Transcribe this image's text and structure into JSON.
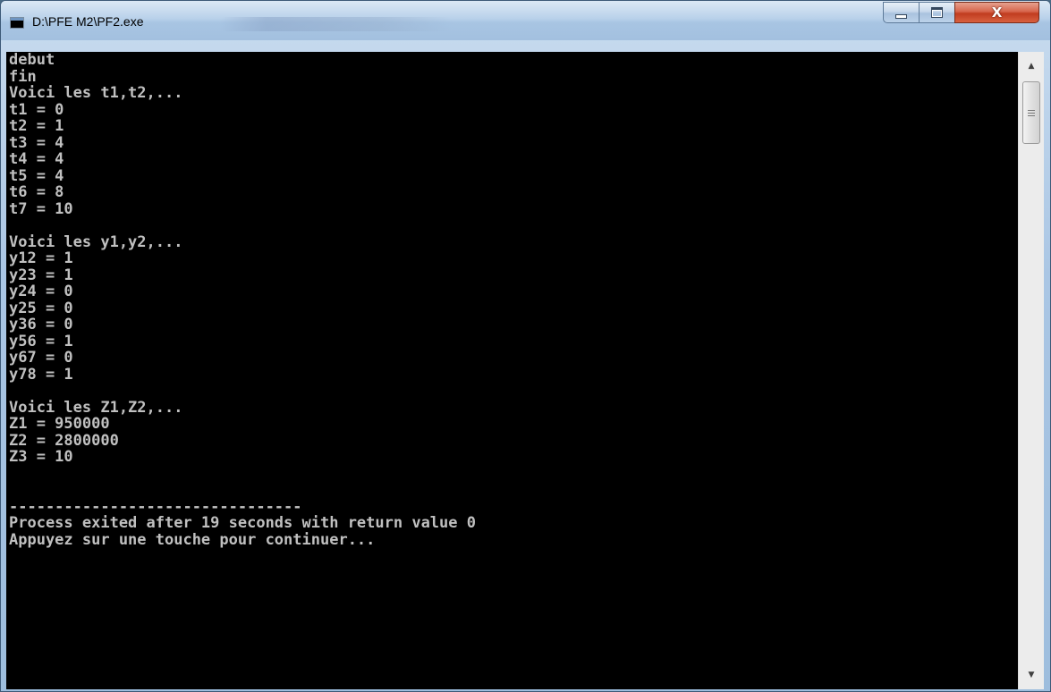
{
  "window": {
    "title": "D:\\PFE M2\\PF2.exe",
    "close_symbol": "X",
    "icons": {
      "app": "console-app-icon",
      "minimize": "minimize-icon",
      "maximize": "maximize-icon",
      "close": "close-icon"
    }
  },
  "console": {
    "lines": [
      "debut",
      "fin",
      "Voici les t1,t2,...",
      "t1 = 0",
      "t2 = 1",
      "t3 = 4",
      "t4 = 4",
      "t5 = 4",
      "t6 = 8",
      "t7 = 10",
      "",
      "Voici les y1,y2,...",
      "y12 = 1",
      "y23 = 1",
      "y24 = 0",
      "y25 = 0",
      "y36 = 0",
      "y56 = 1",
      "y67 = 0",
      "y78 = 1",
      "",
      "Voici les Z1,Z2,...",
      "Z1 = 950000",
      "Z2 = 2800000",
      "Z3 = 10",
      "",
      "",
      "--------------------------------",
      "Process exited after 19 seconds with return value 0",
      "Appuyez sur une touche pour continuer..."
    ]
  },
  "scrollbar": {
    "up_arrow": "▲",
    "down_arrow": "▼",
    "icons": {
      "up": "scroll-up-arrow-icon",
      "down": "scroll-down-arrow-icon",
      "grip": "scroll-grip-icon"
    }
  }
}
